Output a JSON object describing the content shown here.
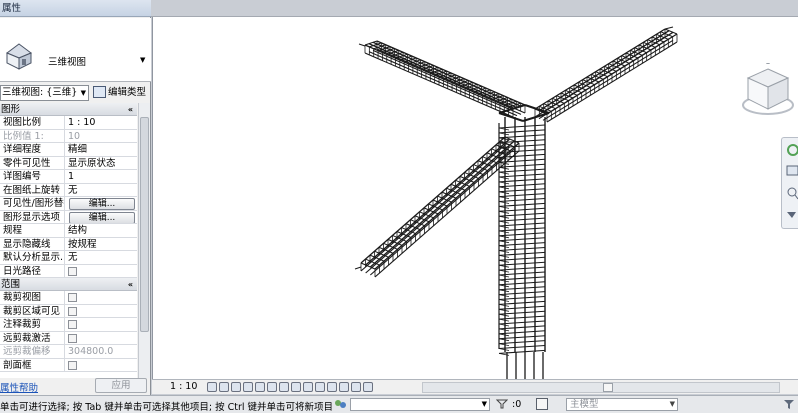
{
  "properties": {
    "panel_title": "属性",
    "type_name": "三维视图",
    "view_selector": "三维视图: {三维}",
    "edit_type_label": "编辑类型",
    "categories": [
      {
        "name": "图形",
        "rows": [
          {
            "label": "视图比例",
            "value": "1 : 10",
            "kind": "text"
          },
          {
            "label": "比例值 1:",
            "value": "10",
            "kind": "disabled"
          },
          {
            "label": "详细程度",
            "value": "精细",
            "kind": "text"
          },
          {
            "label": "零件可见性",
            "value": "显示原状态",
            "kind": "text"
          },
          {
            "label": "详图编号",
            "value": "1",
            "kind": "text"
          },
          {
            "label": "在图纸上旋转",
            "value": "无",
            "kind": "text"
          },
          {
            "label": "可见性/图形替换",
            "value": "编辑...",
            "kind": "button"
          },
          {
            "label": "图形显示选项",
            "value": "编辑...",
            "kind": "button"
          },
          {
            "label": "规程",
            "value": "结构",
            "kind": "text"
          },
          {
            "label": "显示隐藏线",
            "value": "按规程",
            "kind": "text"
          },
          {
            "label": "默认分析显示...",
            "value": "无",
            "kind": "text"
          },
          {
            "label": "日光路径",
            "value": "",
            "kind": "check"
          }
        ]
      },
      {
        "name": "范围",
        "rows": [
          {
            "label": "裁剪视图",
            "value": "",
            "kind": "check"
          },
          {
            "label": "裁剪区域可见",
            "value": "",
            "kind": "check"
          },
          {
            "label": "注释裁剪",
            "value": "",
            "kind": "check"
          },
          {
            "label": "远剪裁激活",
            "value": "",
            "kind": "check"
          },
          {
            "label": "远剪裁偏移",
            "value": "304800.0",
            "kind": "disabled"
          },
          {
            "label": "剖面框",
            "value": "",
            "kind": "check"
          }
        ]
      }
    ],
    "help_link": "属性帮助",
    "apply_button": "应用"
  },
  "view_control": {
    "scale": "1 : 10"
  },
  "status_bar": {
    "message": "单击可进行选择; 按 Tab 键并单击可选择其他项目; 按 Ctrl 键并单击可将新项目添加到选择",
    "selection_count": ":0",
    "model_combo": "主模型"
  },
  "icons": {
    "type_icon": "house-3d-view-icon",
    "view_cube": "viewcube-icon",
    "nav_bar": "navigation-bar-icon"
  },
  "colors": {
    "panel_bg": "#f0f0f0",
    "rebar": "#1a1a1a",
    "link": "#1b53b8"
  }
}
